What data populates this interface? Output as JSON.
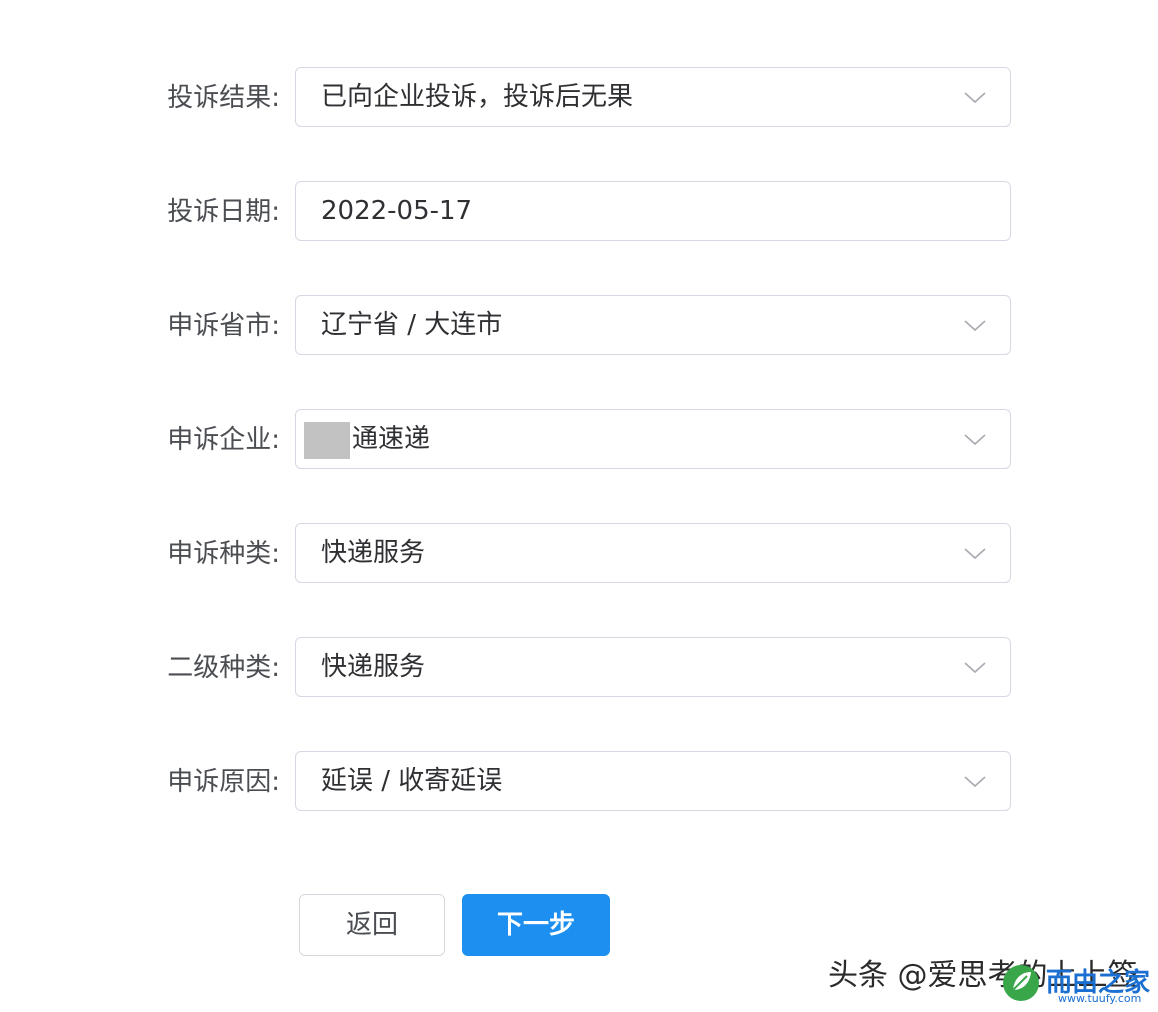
{
  "form": {
    "rows": [
      {
        "label": "投诉结果:",
        "value": "已向企业投诉，投诉后无果",
        "type": "select"
      },
      {
        "label": "投诉日期:",
        "value": "2022-05-17",
        "type": "date"
      },
      {
        "label": "申诉省市:",
        "value": "辽宁省 / 大连市",
        "type": "cascader"
      },
      {
        "label": "申诉企业:",
        "value": "通速递",
        "type": "select"
      },
      {
        "label": "申诉种类:",
        "value": "快递服务",
        "type": "select"
      },
      {
        "label": "二级种类:",
        "value": "快递服务",
        "type": "select"
      },
      {
        "label": "申诉原因:",
        "value": "延误 / 收寄延误",
        "type": "cascader"
      }
    ]
  },
  "buttons": {
    "back_label": "返回",
    "next_label": "下一步"
  },
  "watermark": {
    "text": "头条 @爱思考的上上签"
  },
  "site_logo": {
    "name": "而由之家",
    "url": "www.tuufy.com"
  },
  "icons": {
    "dropdown": "chevron-down-icon",
    "logo": "leaf-logo-icon"
  },
  "colors": {
    "primary": "#1c8ff1",
    "border": "#d5d9e2",
    "label": "#4a4d52",
    "redaction": "#c2c2c2"
  }
}
